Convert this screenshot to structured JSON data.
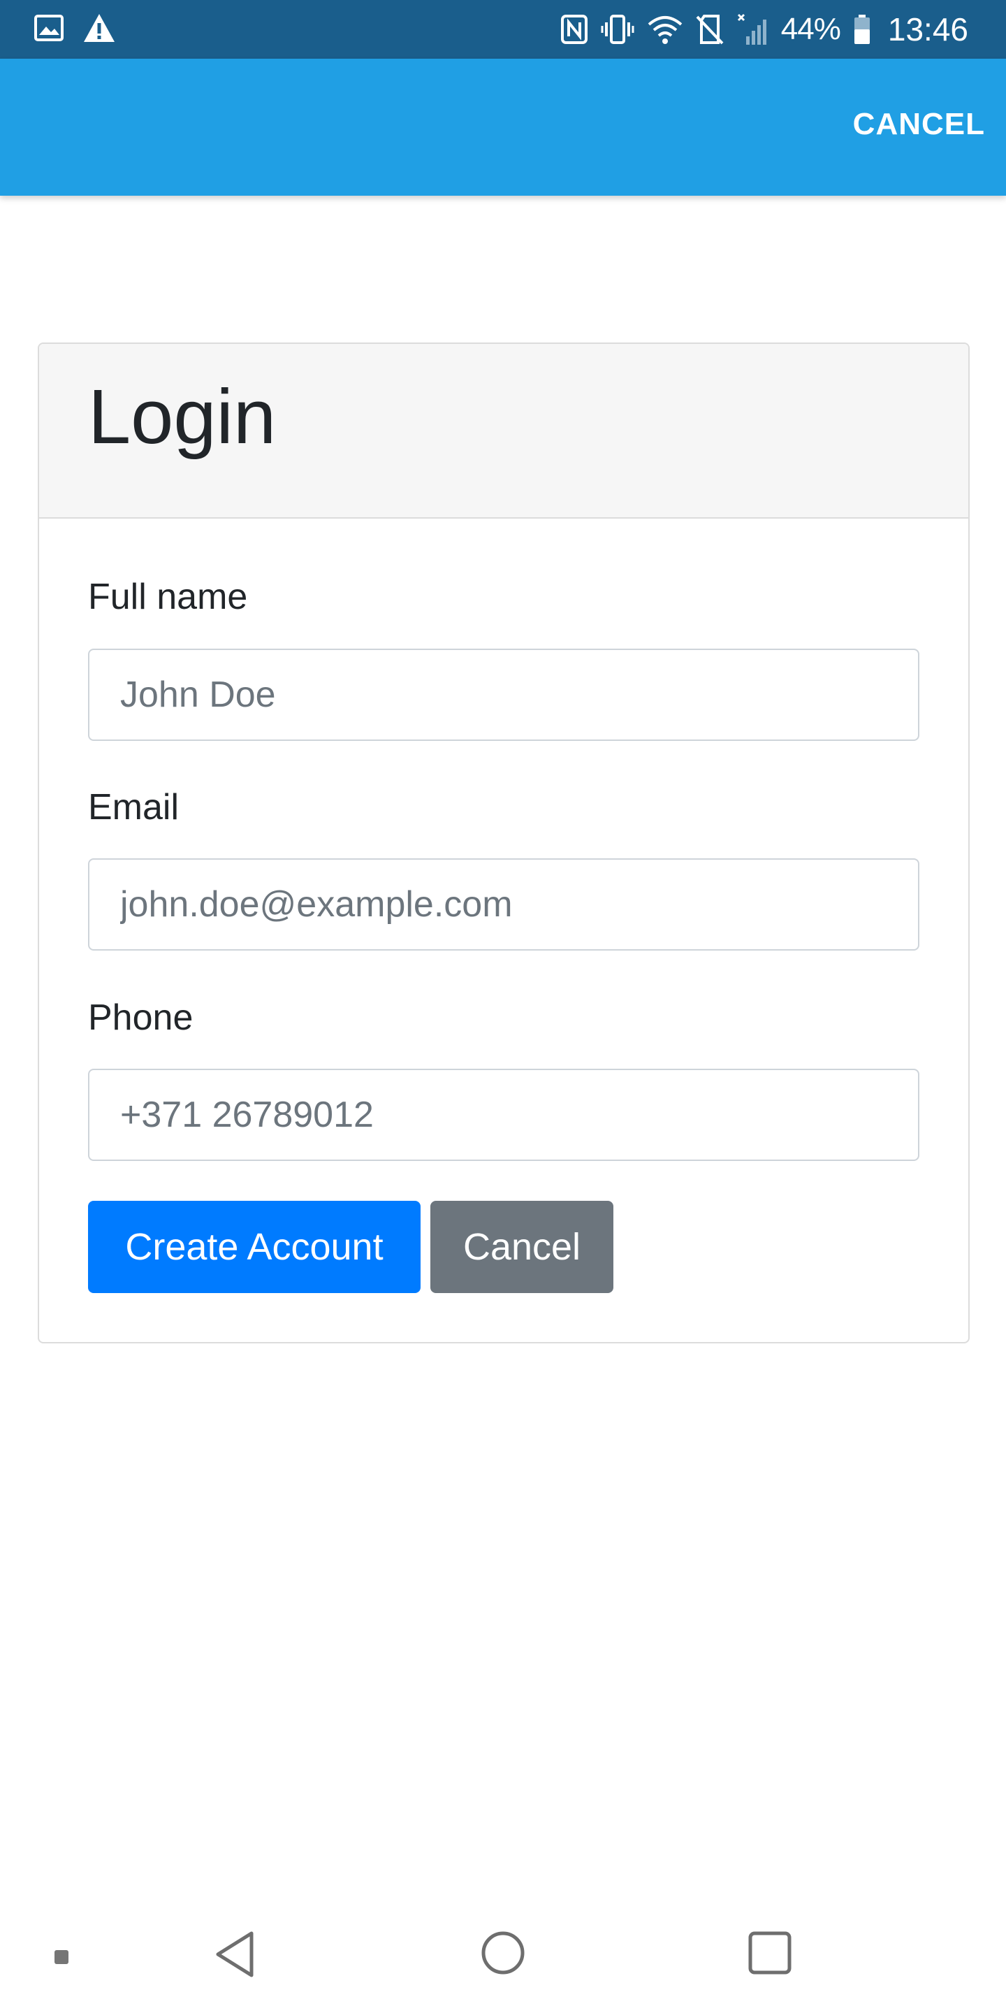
{
  "status_bar": {
    "battery_percent": "44%",
    "time": "13:46",
    "left_icons": [
      "image-icon",
      "warning-icon"
    ],
    "right_icons": [
      "nfc-icon",
      "vibrate-icon",
      "wifi-icon",
      "no-sim-icon",
      "signal-icon",
      "battery-icon"
    ]
  },
  "app_bar": {
    "cancel_label": "CANCEL",
    "color": "#209fe4"
  },
  "card": {
    "title": "Login",
    "fields": [
      {
        "label": "Full name",
        "placeholder": "John Doe",
        "value": ""
      },
      {
        "label": "Email",
        "placeholder": "john.doe@example.com",
        "value": ""
      },
      {
        "label": "Phone",
        "placeholder": "+371 26789012",
        "value": ""
      }
    ],
    "buttons": {
      "create_account": "Create Account",
      "cancel": "Cancel"
    }
  },
  "nav_bar": {
    "icons": [
      "dot-icon",
      "back-icon",
      "home-icon",
      "recents-icon"
    ]
  },
  "colors": {
    "status_bar": "#1a5e8c",
    "primary": "#007bff",
    "secondary": "#6c757d"
  }
}
